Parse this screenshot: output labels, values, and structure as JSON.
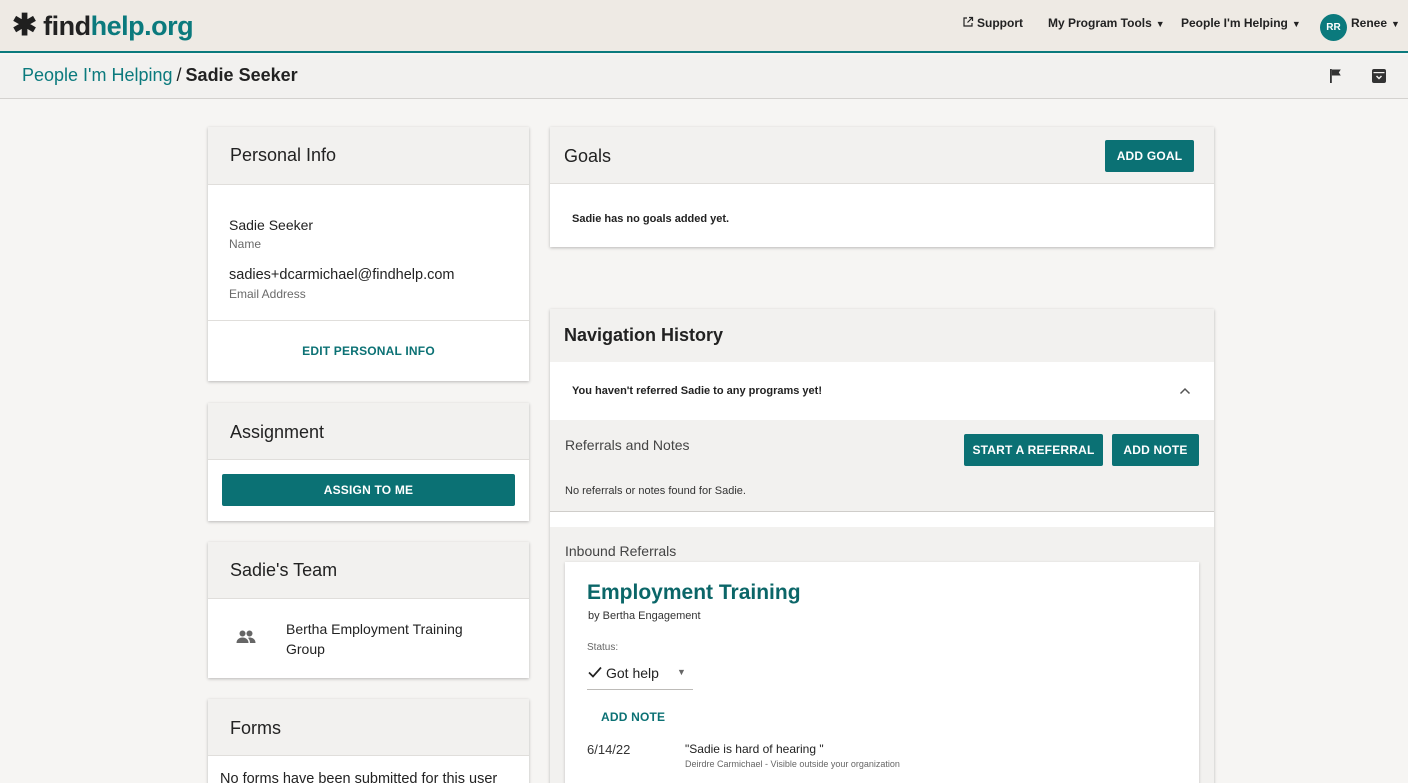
{
  "header": {
    "logo_find": "find",
    "logo_help": "help.org",
    "support": "Support",
    "program_tools": "My Program Tools",
    "people_helping": "People I'm Helping",
    "avatar_initials": "RR",
    "user_name": "Renee"
  },
  "breadcrumb": {
    "parent": "People I'm Helping",
    "separator": "/",
    "current": "Sadie Seeker"
  },
  "personal_info": {
    "title": "Personal Info",
    "name_value": "Sadie Seeker",
    "name_label": "Name",
    "email_value": "sadies+dcarmichael@findhelp.com",
    "email_label": "Email Address",
    "edit_label": "EDIT PERSONAL INFO"
  },
  "assignment": {
    "title": "Assignment",
    "assign_label": "ASSIGN TO ME"
  },
  "team": {
    "title": "Sadie's Team",
    "member_line1": "Bertha Employment Training",
    "member_line2": "Group"
  },
  "forms": {
    "title": "Forms",
    "empty_text": "No forms have been submitted for this user"
  },
  "goals": {
    "title": "Goals",
    "add_label": "ADD GOAL",
    "empty_text": "Sadie has no goals added yet."
  },
  "navigation_history": {
    "title": "Navigation History",
    "not_referred": "You haven't referred Sadie to any programs yet!",
    "referrals_notes_title": "Referrals and Notes",
    "start_referral_label": "START A REFERRAL",
    "add_note_label": "ADD NOTE",
    "no_referrals_text": "No referrals or notes found for Sadie.",
    "inbound_title": "Inbound Referrals"
  },
  "inbound_referral": {
    "program_name": "Employment Training",
    "by_line": "by Bertha Engagement",
    "status_label": "Status:",
    "status_value": "Got help",
    "add_note_label": "ADD NOTE",
    "note_date": "6/14/22",
    "note_text": "\"Sadie is hard of hearing \"",
    "note_meta": "Deirdre Carmichael - Visible outside your organization"
  },
  "colors": {
    "brand_teal": "#0b7a7d",
    "button_teal": "#0b7174",
    "header_bg": "#eeeae4"
  },
  "icons": [
    "asterisk-logo-icon",
    "external-link-icon",
    "caret-down-icon",
    "flag-icon",
    "archive-icon",
    "group-icon",
    "chevron-up-icon",
    "check-icon"
  ]
}
